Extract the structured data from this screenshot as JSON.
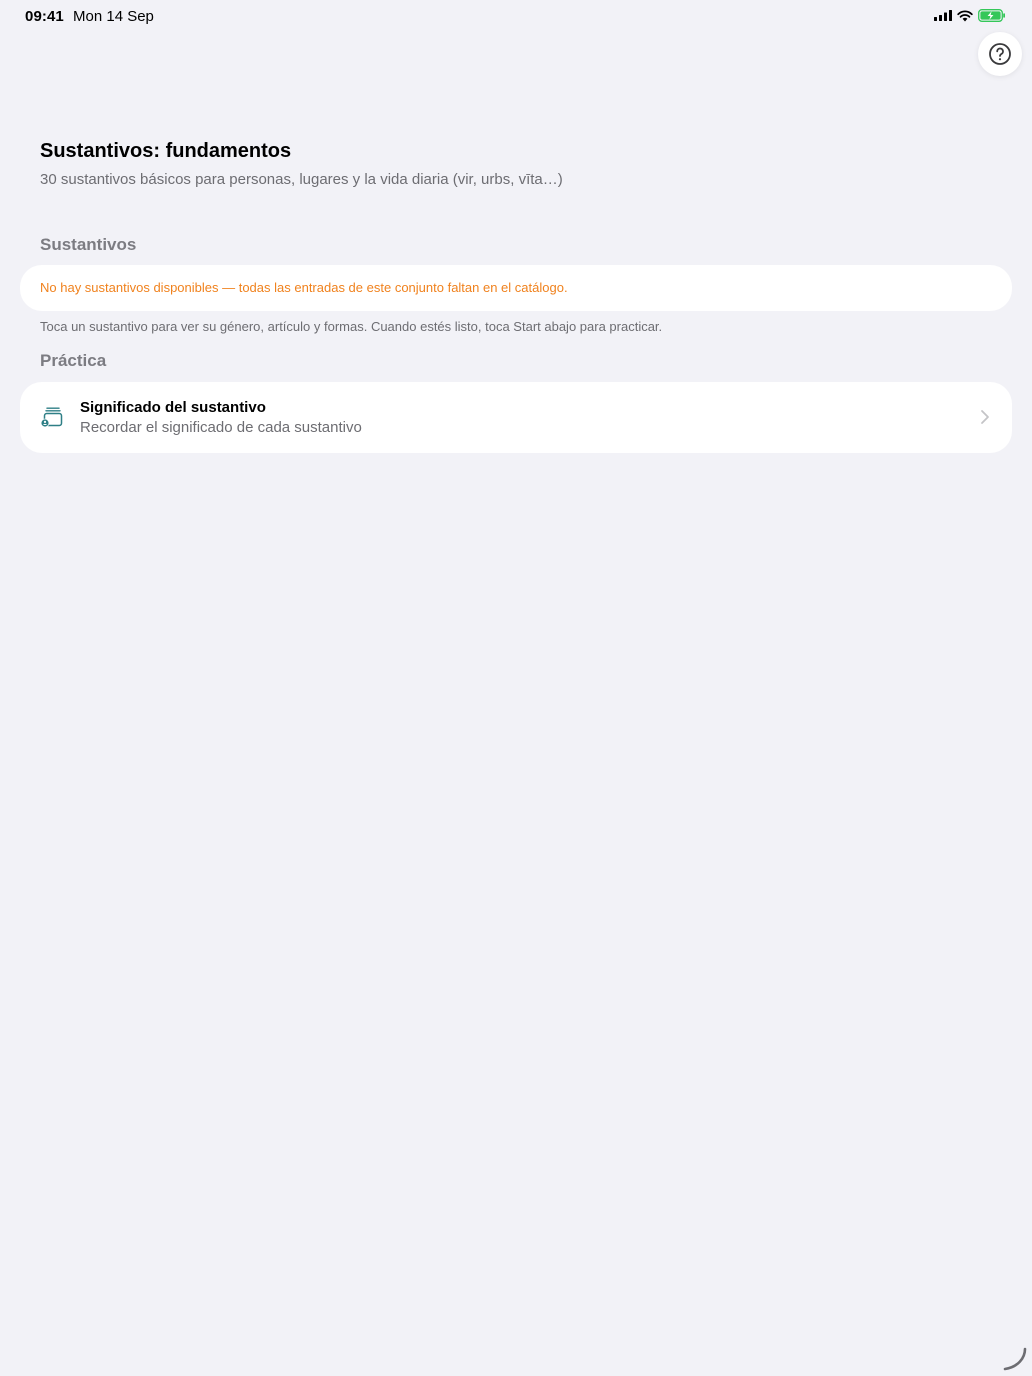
{
  "status_bar": {
    "time": "09:41",
    "date": "Mon 14 Sep"
  },
  "page": {
    "title": "Sustantivos: fundamentos",
    "subtitle": "30 sustantivos básicos para personas, lugares y la vida diaria (vir, urbs, vīta…)"
  },
  "nouns_section": {
    "header": "Sustantivos",
    "warning": "No hay sustantivos disponibles — todas las entradas de este conjunto faltan en el catálogo.",
    "hint": "Toca un sustantivo para ver su género, artículo y formas. Cuando estés listo, toca Start abajo para practicar."
  },
  "practice_section": {
    "header": "Práctica",
    "items": [
      {
        "title": "Significado del sustantivo",
        "subtitle": "Recordar el significado de cada sustantivo",
        "icon": "cards-icon"
      }
    ]
  },
  "colors": {
    "background": "#f2f2f7",
    "warning": "#f0821e",
    "accent_icon": "#2e7f86",
    "battery": "#34c759"
  }
}
